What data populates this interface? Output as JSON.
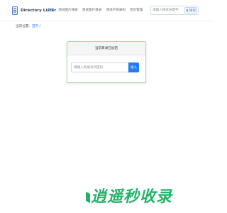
{
  "header": {
    "logo_text": "Directory Lister",
    "nav": [
      {
        "label": "首页",
        "active": true
      },
      {
        "label": "测试图片搜索",
        "active": false
      },
      {
        "label": "测试图片目录",
        "active": false
      },
      {
        "label": "测试子目录树",
        "active": false
      },
      {
        "label": "后台管理",
        "active": false
      }
    ],
    "search": {
      "placeholder": "请输入搜索关键字",
      "button_label": "搜索"
    }
  },
  "breadcrumb": {
    "prefix": "当前位置：",
    "home": "首页",
    "separator": "/"
  },
  "panel": {
    "title": "当前目录已加密",
    "password_placeholder": "请输入目录访问密码",
    "submit_label": "进入"
  },
  "watermark": {
    "text": "逍遥秒收录"
  },
  "colors": {
    "accent": "#2f7ff7",
    "button": "#1f7cf3",
    "panel_border": "#a9dca9",
    "watermark": "#22b36a"
  }
}
